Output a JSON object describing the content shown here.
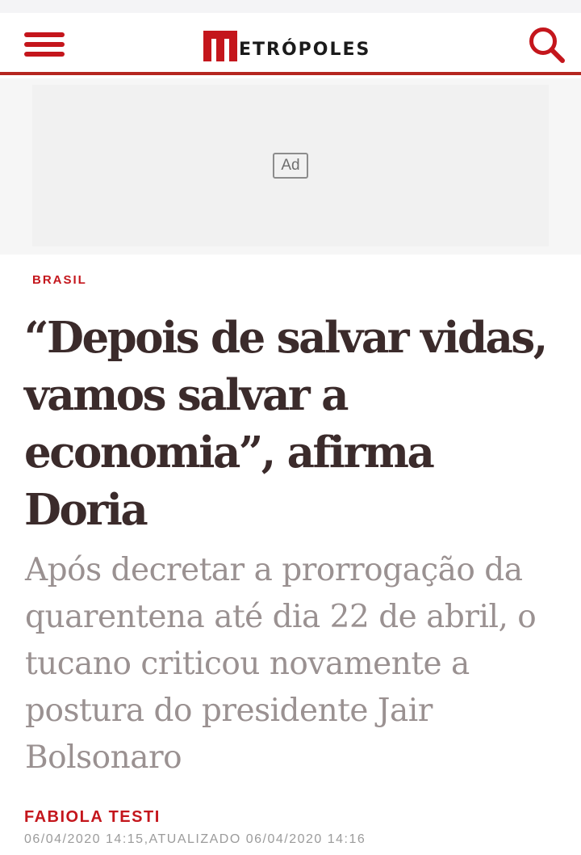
{
  "header": {
    "logo_text": "ETRÓPOLES",
    "logo_full": "METRÓPOLES",
    "menu_icon": "hamburger-menu-icon",
    "search_icon": "search-icon",
    "brand_color": "#c4161c",
    "border_color": "#b5261f"
  },
  "ad": {
    "label": "Ad"
  },
  "article": {
    "category": "BRASIL",
    "headline": "“Depois de salvar vidas, vamos salvar a economia”, afirma Doria",
    "subtitle": "Após decretar a prorrogação da quarentena até dia 22 de abril, o tucano criticou novamente a postura do presidente Jair Bolsonaro",
    "author": "FABIOLA TESTI",
    "dateline": "06/04/2020 14:15,ATUALIZADO 06/04/2020 14:16",
    "headline_color": "#3b2b2b",
    "subtitle_color": "#9a9191"
  }
}
